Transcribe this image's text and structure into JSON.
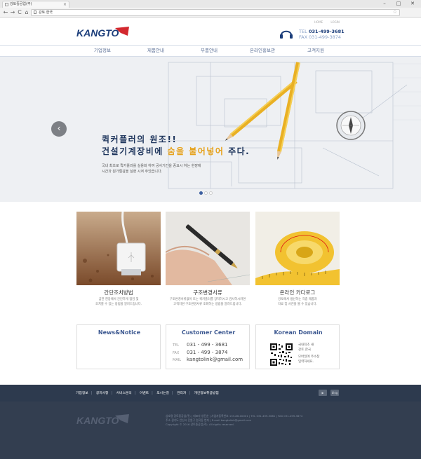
{
  "browser": {
    "tab_title": "강토중공업(주)",
    "tab_close": "×",
    "url": "강토.한국",
    "back": "←",
    "forward": "→",
    "reload": "C",
    "home": "⌂",
    "bookmark": "☆",
    "win_min": "–",
    "win_max": "□",
    "win_close": "✕"
  },
  "header": {
    "top_links": [
      "HOME",
      "LOGIN"
    ],
    "logo_text": "KANGTO",
    "tel_label": "TEL",
    "tel": "031-499-3681",
    "fax_label": "FAX",
    "fax": "031-499-3874"
  },
  "gnb": [
    "기업정보",
    "제품안내",
    "부품안내",
    "온라인홍보관",
    "고객지원"
  ],
  "hero": {
    "title_line1": "퀵커플러의 원조!!",
    "title_line2_a": "건설기계장비에 ",
    "title_line2_hl": "숨을 불어넣어",
    "title_line2_b": " 주다.",
    "desc_line1": "국내 최초로 퀵커플러를 실용화 하여 공사기간을 중요시 하는 현장에",
    "desc_line2": "시간과 원가절감을 실현 시켜 주었습니다.",
    "prev": "‹",
    "slide_index": 1,
    "slide_count": 3
  },
  "cards": [
    {
      "title": "간단조치방법",
      "desc1": "급한 현장에서 간단하게 점검 및",
      "desc2": "조치할 수 있는 방법을 알려드립니다."
    },
    {
      "title": "구조변경서류",
      "desc1": "구조변경서류없이 또는 퀵커플러를 장착하시고 검사하시려면",
      "desc2": "고객지원 구조변경서류 조회하는 방법을 알려드립니다."
    },
    {
      "title": "온라인 카다로그",
      "desc1": "강토에서 생산하는 각종 제품과",
      "desc2": "자료 및 사진을 볼 수 있습니다."
    }
  ],
  "boxes": {
    "news_title": "News&Notice",
    "cc_title": "Customer Center",
    "tel_key": "TEL",
    "tel": "031 - 499 - 3681",
    "fax_key": "FAX",
    "fax": "031 - 499 - 3874",
    "mail_key": "MAIL",
    "mail": "kangtolink@gmail.com",
    "kd_title": "Korean Domain",
    "kd_line1": "국내최초 새",
    "kd_line2": "강토.한국",
    "kd_line3": "모바일에 주소창",
    "kd_line4": "입력하세요."
  },
  "footer": {
    "nav": [
      "기업정보",
      "공지사항",
      "서비스문의",
      "이벤트",
      "오시는길",
      "관리자",
      "개인정보취급방침"
    ],
    "sns1": "▶",
    "sns2": "blog",
    "logo_text": "KANGTO",
    "info1": "상호명 강토중공업(주) | 대표자 양진순 | 사업자등록번호 133-86-00001 | TEL 031-499-3681 | FAX 031-499-3874",
    "info2": "주소 경기도 안산시 단원구 원곡동 번지 | E-mail kangtolink@gmail.com",
    "info3": "Copyright © 2016 강토중공업(주). All rights reserved."
  },
  "colors": {
    "brand_blue": "#1b3d7a",
    "accent_orange": "#e6a21c",
    "footer_dark": "#333e50"
  }
}
